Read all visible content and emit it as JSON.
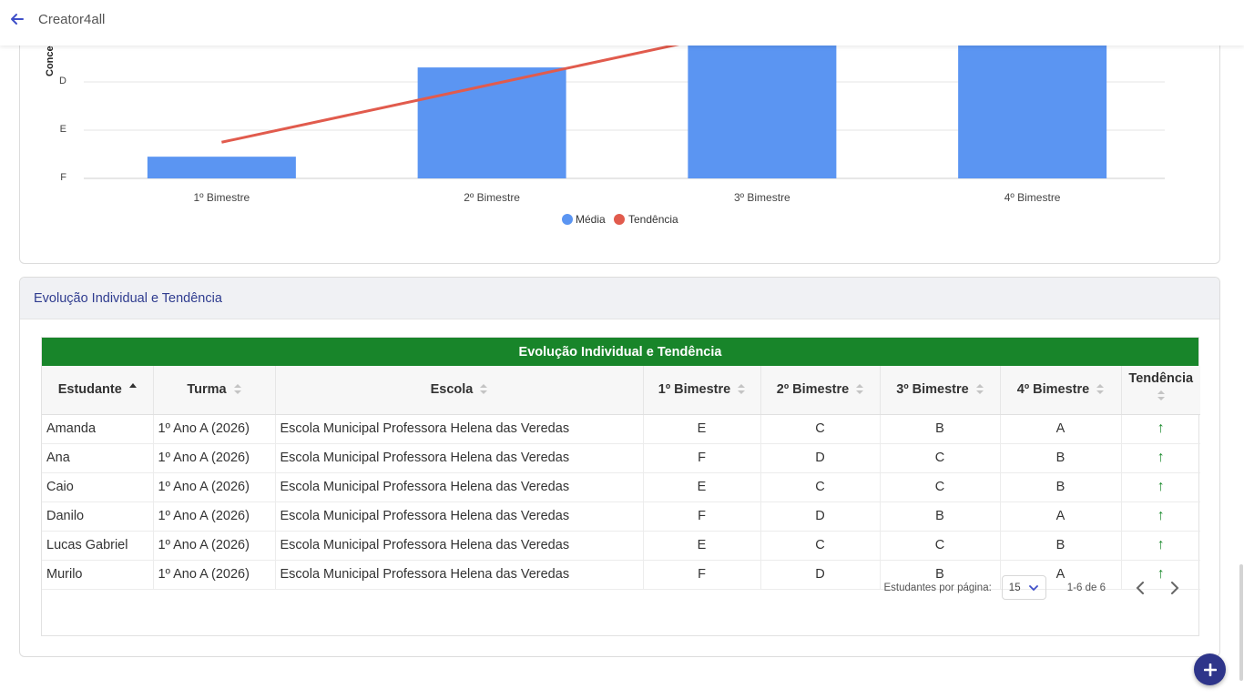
{
  "app": {
    "title": "Creator4all"
  },
  "chart_data": {
    "type": "bar",
    "categories": [
      "1º Bimestre",
      "2º Bimestre",
      "3º Bimestre",
      "4º Bimestre"
    ],
    "y_ticks": [
      "F",
      "E",
      "D"
    ],
    "ylabel_visible": "Conce",
    "series": [
      {
        "name": "Média",
        "type": "bar",
        "values": [
          0.45,
          2.3,
          3.6,
          3.6
        ],
        "color": "#5b95f2"
      },
      {
        "name": "Tendência",
        "type": "line",
        "values": [
          0.75,
          1.95,
          3.15,
          4.35
        ],
        "color": "#e15b4d"
      }
    ],
    "ylim": [
      0,
      3
    ]
  },
  "legend": {
    "media": "Média",
    "tendencia": "Tendência"
  },
  "section": {
    "title": "Evolução Individual e Tendência",
    "banner": "Evolução Individual e Tendência"
  },
  "table": {
    "headers": {
      "estudante": "Estudante",
      "turma": "Turma",
      "escola": "Escola",
      "b1": "1º Bimestre",
      "b2": "2º Bimestre",
      "b3": "3º Bimestre",
      "b4": "4º Bimestre",
      "tendencia": "Tendência"
    },
    "rows": [
      {
        "estudante": "Amanda",
        "turma": "1º Ano A (2026)",
        "escola": "Escola Municipal Professora Helena das Veredas",
        "b1": "E",
        "b2": "C",
        "b3": "B",
        "b4": "A",
        "trend": "↑"
      },
      {
        "estudante": "Ana",
        "turma": "1º Ano A (2026)",
        "escola": "Escola Municipal Professora Helena das Veredas",
        "b1": "F",
        "b2": "D",
        "b3": "C",
        "b4": "B",
        "trend": "↑"
      },
      {
        "estudante": "Caio",
        "turma": "1º Ano A (2026)",
        "escola": "Escola Municipal Professora Helena das Veredas",
        "b1": "E",
        "b2": "C",
        "b3": "C",
        "b4": "B",
        "trend": "↑"
      },
      {
        "estudante": "Danilo",
        "turma": "1º Ano A (2026)",
        "escola": "Escola Municipal Professora Helena das Veredas",
        "b1": "F",
        "b2": "D",
        "b3": "B",
        "b4": "A",
        "trend": "↑"
      },
      {
        "estudante": "Lucas Gabriel",
        "turma": "1º Ano A (2026)",
        "escola": "Escola Municipal Professora Helena das Veredas",
        "b1": "E",
        "b2": "C",
        "b3": "C",
        "b4": "B",
        "trend": "↑"
      },
      {
        "estudante": "Murilo",
        "turma": "1º Ano A (2026)",
        "escola": "Escola Municipal Professora Helena das Veredas",
        "b1": "F",
        "b2": "D",
        "b3": "B",
        "b4": "A",
        "trend": "↑"
      }
    ]
  },
  "pager": {
    "label": "Estudantes por página:",
    "per_page": "15",
    "range": "1-6 de 6"
  },
  "colors": {
    "accent": "#2e358a",
    "banner": "#18852a",
    "trend_up": "#1a8a2c"
  }
}
